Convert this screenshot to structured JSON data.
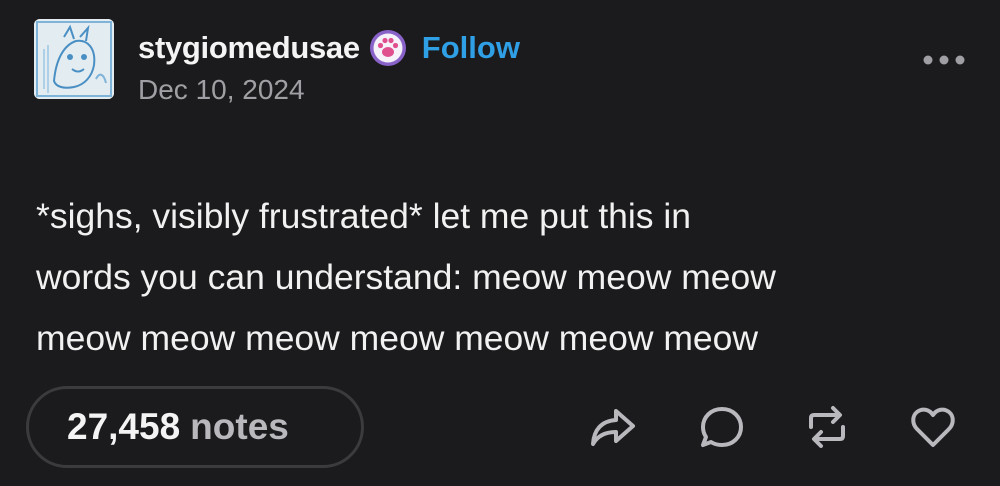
{
  "post": {
    "author": {
      "username": "stygiomedusae",
      "follow_label": "Follow",
      "date": "Dec 10, 2024",
      "avatar_icon": "avatar-image",
      "badge_icon": "paw-badge-icon"
    },
    "menu_icon": "more-dots-icon",
    "content": {
      "lines": [
        "*sighs, visibly frustrated* let me put this in",
        "words you can understand: meow meow meow",
        "meow meow meow meow meow meow meow"
      ]
    },
    "footer": {
      "notes_count": "27,458",
      "notes_label": "notes",
      "actions": [
        "share-icon",
        "reply-icon",
        "reblog-icon",
        "like-icon"
      ]
    }
  },
  "colors": {
    "background": "#1b1b1d",
    "accent_follow": "#2f9fe6",
    "secondary_text": "#a0a0a4",
    "badge_purple": "#8a63c9"
  }
}
